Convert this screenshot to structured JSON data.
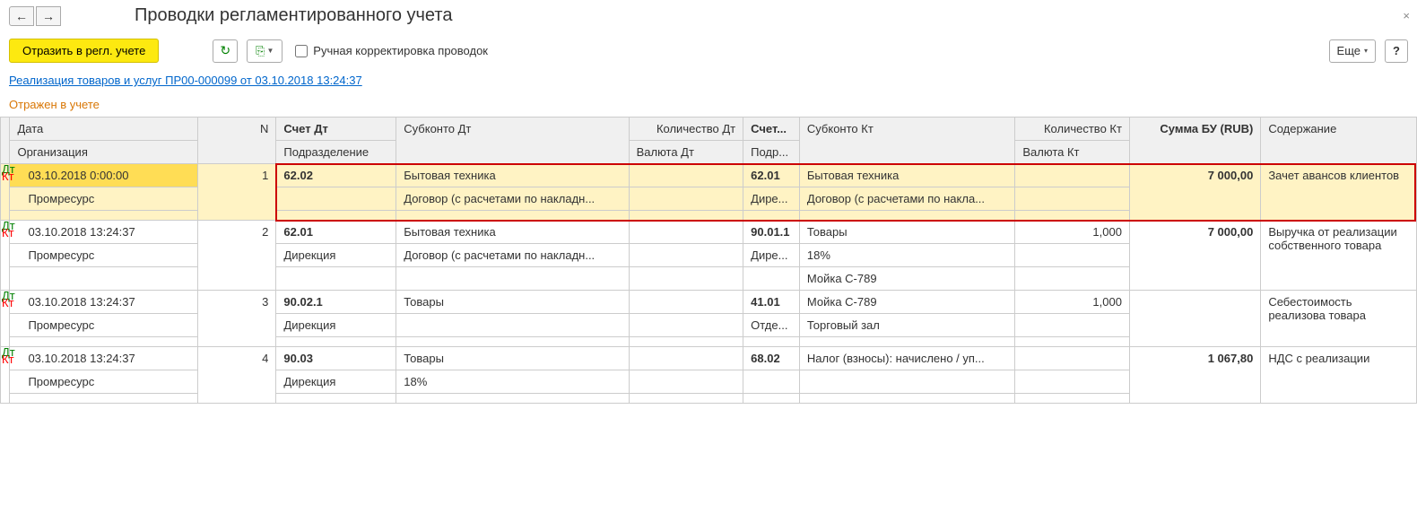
{
  "nav": {
    "back": "←",
    "forward": "→"
  },
  "page_title": "Проводки регламентированного учета",
  "close_x": "×",
  "toolbar": {
    "reflect_button": "Отразить в регл. учете",
    "manual_checkbox_label": "Ручная корректировка проводок",
    "more_button": "Еще",
    "help_button": "?"
  },
  "doc_link": "Реализация товаров и услуг ПР00-000099 от 03.10.2018 13:24:37",
  "status_text": "Отражен в учете",
  "headers": {
    "date": "Дата",
    "n": "N",
    "acc_dt": "Счет Дт",
    "sub_dt": "Субконто Дт",
    "qty_dt": "Количество Дт",
    "acc_kt": "Счет...",
    "sub_kt": "Субконто Кт",
    "qty_kt": "Количество Кт",
    "sum": "Сумма БУ (RUB)",
    "content": "Содержание",
    "org": "Организация",
    "division": "Подразделение",
    "currency_dt": "Валюта Дт",
    "division_kt": "Подр...",
    "currency_kt": "Валюта Кт"
  },
  "rows": [
    {
      "highlighted": true,
      "date": "03.10.2018 0:00:00",
      "n": "1",
      "acc_dt": "62.02",
      "sub_dt_1": "Бытовая техника",
      "sub_dt_2": "Договор (с расчетами по накладн...",
      "sub_dt_3": "",
      "qty_dt": "",
      "acc_kt": "62.01",
      "sub_kt_1": "Бытовая техника",
      "sub_kt_2": "Договор (с расчетами по накла...",
      "sub_kt_3": "",
      "qty_kt": "",
      "sum": "7 000,00",
      "content": "Зачет авансов клиентов",
      "org": "Промресурс",
      "division": "",
      "currency_dt": "",
      "div_kt": "Дире...",
      "currency_kt": ""
    },
    {
      "highlighted": false,
      "date": "03.10.2018 13:24:37",
      "n": "2",
      "acc_dt": "62.01",
      "sub_dt_1": "Бытовая техника",
      "sub_dt_2": "Договор (с расчетами по накладн...",
      "sub_dt_3": "",
      "qty_dt": "",
      "acc_kt": "90.01.1",
      "sub_kt_1": "Товары",
      "sub_kt_2": "18%",
      "sub_kt_3": "Мойка С-789",
      "qty_kt": "1,000",
      "sum": "7 000,00",
      "content": "Выручка от реализации собственного товара",
      "org": "Промресурс",
      "division": "Дирекция",
      "currency_dt": "",
      "div_kt": "Дире...",
      "currency_kt": ""
    },
    {
      "highlighted": false,
      "date": "03.10.2018 13:24:37",
      "n": "3",
      "acc_dt": "90.02.1",
      "sub_dt_1": "Товары",
      "sub_dt_2": "",
      "sub_dt_3": "",
      "qty_dt": "",
      "acc_kt": "41.01",
      "sub_kt_1": "Мойка С-789",
      "sub_kt_2": "Торговый зал",
      "sub_kt_3": "",
      "qty_kt": "1,000",
      "sum": "",
      "content": "Себестоимость реализова товара",
      "org": "Промресурс",
      "division": "Дирекция",
      "currency_dt": "",
      "div_kt": "Отде...",
      "currency_kt": ""
    },
    {
      "highlighted": false,
      "date": "03.10.2018 13:24:37",
      "n": "4",
      "acc_dt": "90.03",
      "sub_dt_1": "Товары",
      "sub_dt_2": "18%",
      "sub_dt_3": "",
      "qty_dt": "",
      "acc_kt": "68.02",
      "sub_kt_1": "Налог (взносы): начислено / уп...",
      "sub_kt_2": "",
      "sub_kt_3": "",
      "qty_kt": "",
      "sum": "1 067,80",
      "content": "НДС с реализации",
      "org": "Промресурс",
      "division": "Дирекция",
      "currency_dt": "",
      "div_kt": "",
      "currency_kt": ""
    }
  ]
}
